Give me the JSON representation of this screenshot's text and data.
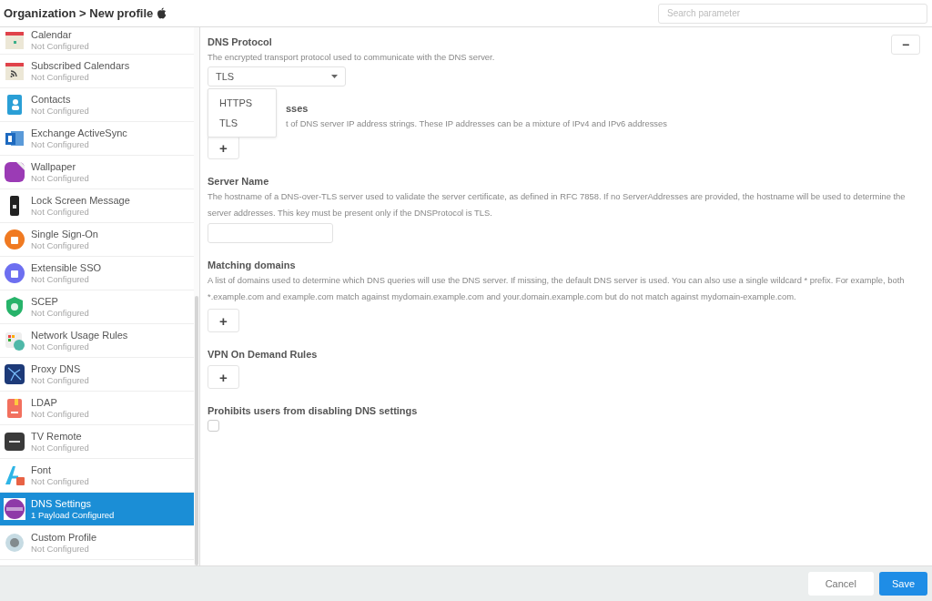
{
  "header": {
    "breadcrumb": "Organization > New profile",
    "search": {
      "placeholder": "Search parameter"
    }
  },
  "sidebar": {
    "items": [
      {
        "kind": "calendar",
        "title": "Calendar",
        "status": "Not Configured",
        "selected": false
      },
      {
        "kind": "subscribed",
        "title": "Subscribed Calendars",
        "status": "Not Configured",
        "selected": false
      },
      {
        "kind": "contacts",
        "title": "Contacts",
        "status": "Not Configured",
        "selected": false
      },
      {
        "kind": "exchange",
        "title": "Exchange ActiveSync",
        "status": "Not Configured",
        "selected": false
      },
      {
        "kind": "wallpaper",
        "title": "Wallpaper",
        "status": "Not Configured",
        "selected": false
      },
      {
        "kind": "lock",
        "title": "Lock Screen Message",
        "status": "Not Configured",
        "selected": false
      },
      {
        "kind": "sso",
        "title": "Single Sign-On",
        "status": "Not Configured",
        "selected": false
      },
      {
        "kind": "esso",
        "title": "Extensible SSO",
        "status": "Not Configured",
        "selected": false
      },
      {
        "kind": "scep",
        "title": "SCEP",
        "status": "Not Configured",
        "selected": false
      },
      {
        "kind": "network",
        "title": "Network Usage Rules",
        "status": "Not Configured",
        "selected": false
      },
      {
        "kind": "proxy",
        "title": "Proxy DNS",
        "status": "Not Configured",
        "selected": false
      },
      {
        "kind": "ldap",
        "title": "LDAP",
        "status": "Not Configured",
        "selected": false
      },
      {
        "kind": "tv",
        "title": "TV Remote",
        "status": "Not Configured",
        "selected": false
      },
      {
        "kind": "font",
        "title": "Font",
        "status": "Not Configured",
        "selected": false
      },
      {
        "kind": "dns",
        "title": "DNS Settings",
        "status": "1 Payload Configured",
        "selected": true
      },
      {
        "kind": "custom",
        "title": "Custom Profile",
        "status": "Not Configured",
        "selected": false
      }
    ]
  },
  "form": {
    "sections": [
      {
        "kind": "select",
        "title": "DNS Protocol",
        "description": "The encrypted transport protocol used to communicate with the DNS server.",
        "value": "TLS",
        "menu": [
          {
            "label": "HTTPS"
          },
          {
            "label": "TLS"
          }
        ]
      },
      {
        "kind": "partial_list",
        "title": "sses",
        "description": "t of DNS server IP address strings. These IP addresses can be a mixture of IPv4 and IPv6 addresses",
        "add": "+"
      },
      {
        "kind": "text",
        "title": "Server Name",
        "description": "The hostname of a DNS-over-TLS server used to validate the server certificate, as defined in RFC 7858. If no ServerAddresses are provided, the hostname will be used to determine the server addresses. This key must be present only if the DNSProtocol is TLS."
      },
      {
        "kind": "list",
        "title": "Matching domains",
        "description": "A list of domains used to determine which DNS queries will use the DNS server. If missing, the default DNS server is used. You can also use a single wildcard * prefix. For example, both *.example.com and example.com match against mydomain.example.com and your.domain.example.com but do not match against mydomain-example.com.",
        "add": "+"
      },
      {
        "kind": "list",
        "title": "VPN On Demand Rules",
        "add": "+"
      },
      {
        "kind": "checkbox",
        "title": "Prohibits users from disabling DNS settings",
        "checked": false
      }
    ],
    "remove": "−"
  },
  "footer": {
    "buttons": [
      {
        "kind": "secondary",
        "label": "Cancel"
      },
      {
        "kind": "primary",
        "label": "Save"
      }
    ]
  }
}
